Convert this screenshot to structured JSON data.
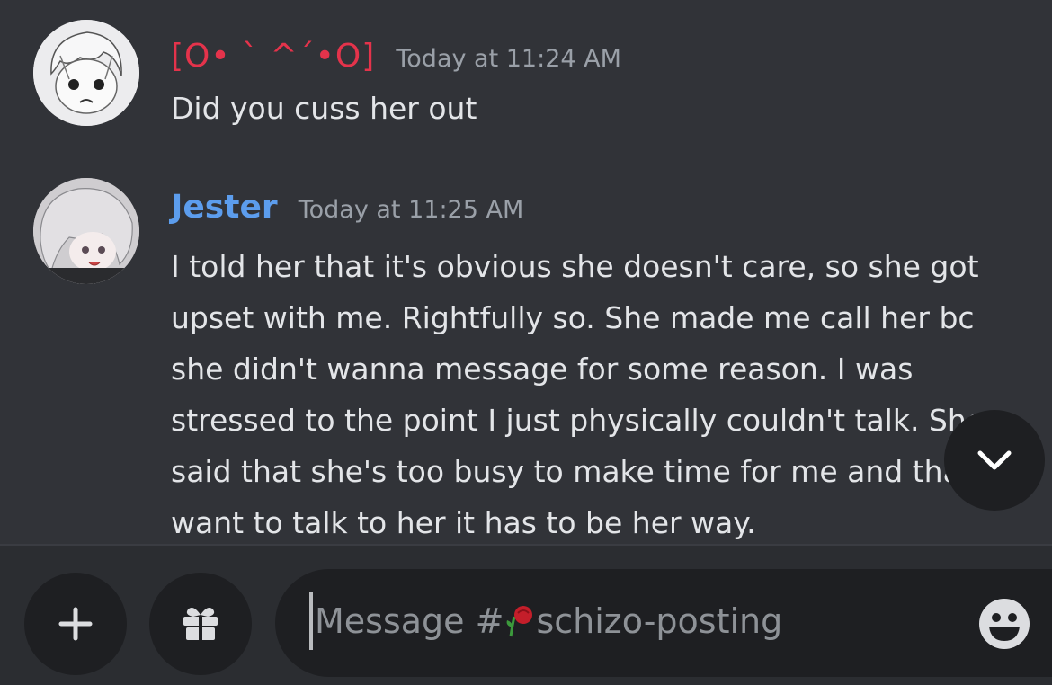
{
  "channel": {
    "composer_placeholder_prefix": "Message #",
    "composer_placeholder_name": "schizo-posting"
  },
  "messages": [
    {
      "username": "[O• ˋ ^ˊ•O]",
      "timestamp": "Today at 11:24 AM",
      "username_color": "#e4334b",
      "lines": [
        "Did you cuss her out"
      ]
    },
    {
      "username": "Jester",
      "timestamp": "Today at 11:25 AM",
      "username_color": "#5c9ded",
      "lines": [
        "I told her that it's obvious she doesn't care, so she got",
        "upset with me. Rightfully so. She made me call her bc",
        "she didn't wanna message for some reason. I was",
        "stressed to the point I just physically couldn't talk. She",
        "said that she's too busy to make time for me and that if I",
        "want to talk to her it has to be her way."
      ]
    }
  ],
  "icons": {
    "jump": "chevron-down-icon",
    "plus": "plus-icon",
    "gift": "gift-icon",
    "emoji": "emoji-icon",
    "channel_emoji": "rose-icon"
  }
}
